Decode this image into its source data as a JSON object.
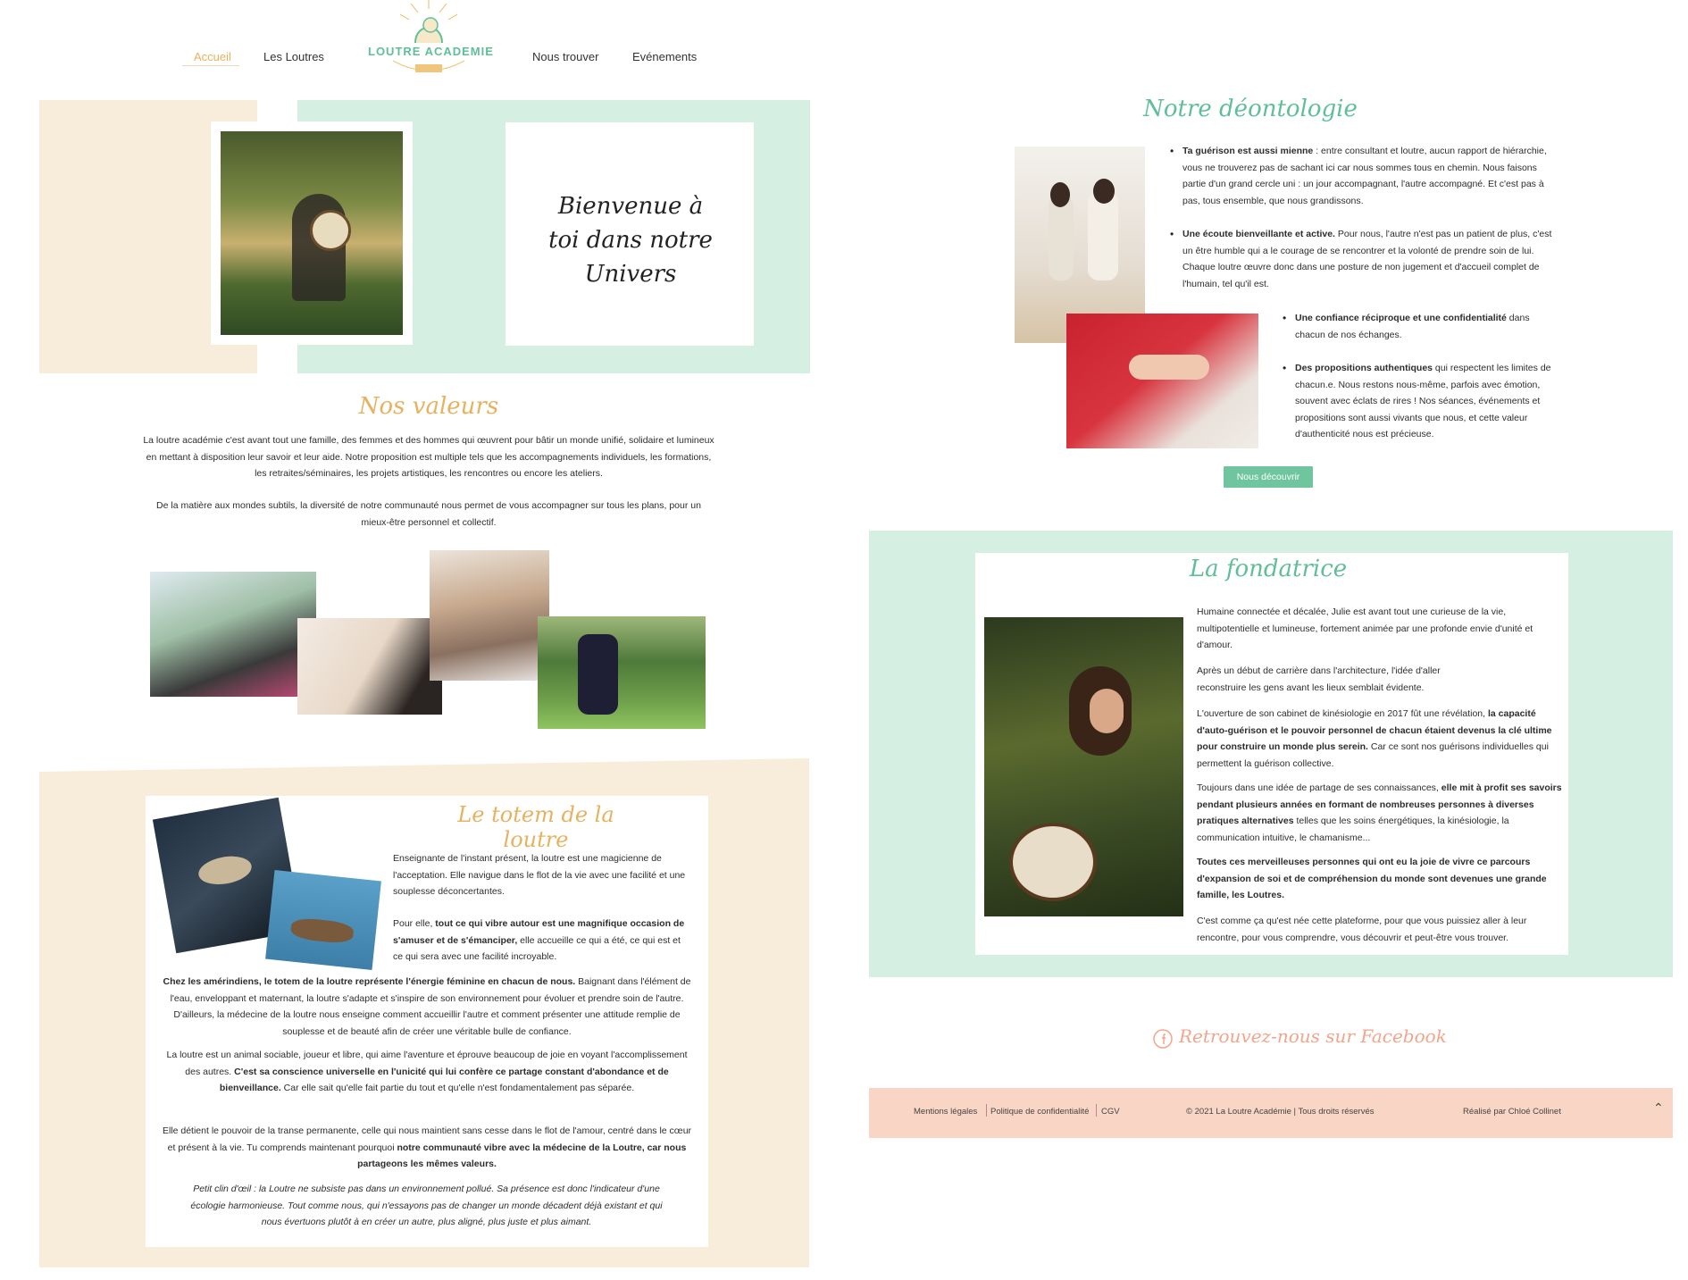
{
  "nav": {
    "items": [
      {
        "label": "Accueil"
      },
      {
        "label": "Les Loutres"
      },
      {
        "label": "Nous trouver"
      },
      {
        "label": "Evénements"
      }
    ],
    "logo_text": "LOUTRE ACADEMIE"
  },
  "hero": {
    "welcome": "Bienvenue à toi dans notre Univers"
  },
  "valeurs": {
    "title": "Nos valeurs",
    "p1": "La loutre académie c'est avant tout une famille, des femmes et des hommes qui œuvrent pour bâtir un monde unifié, solidaire et lumineux en mettant à disposition leur savoir et leur aide. Notre proposition est multiple tels que les accompagnements individuels, les formations, les retraites/séminaires, les projets artistiques, les rencontres ou encore les ateliers.",
    "p2": "De la matière aux mondes subtils, la diversité de notre communauté nous permet de vous accompagner sur tous les plans, pour un mieux-être personnel et collectif."
  },
  "totem": {
    "title": "Le totem de la loutre",
    "p1": "Enseignante de l'instant présent, la loutre est une magicienne de l'acceptation. Elle navigue dans le flot de la vie avec une facilité et une souplesse déconcertantes.",
    "p2_a": "Pour elle, ",
    "p2_b": "tout ce qui vibre autour est une magnifique occasion de s'amuser et de s'émanciper,",
    "p2_c": " elle accueille ce qui a été, ce qui est et ce qui sera avec une facilité incroyable.",
    "p3_a": "Chez les amérindiens, le totem de la loutre représente l'énergie féminine en chacun de nous.",
    "p3_b": " Baignant dans l'élément de l'eau, enveloppant et maternant, la loutre s'adapte et s'inspire de son environnement pour évoluer et prendre soin de l'autre. D'ailleurs, la médecine de la loutre nous enseigne comment accueillir l'autre et comment présenter une attitude remplie de souplesse et de beauté afin de créer une véritable bulle de confiance.",
    "p4_a": "La loutre est un animal sociable, joueur et libre, qui aime l'aventure et éprouve beaucoup de joie en voyant l'accomplissement des autres. ",
    "p4_b": "C'est sa conscience universelle en l'unicité qui lui confère ce partage constant d'abondance et de bienveillance.",
    "p4_c": " Car elle sait qu'elle fait partie du tout et qu'elle n'est fondamentalement pas séparée.",
    "p5_a": "Elle détient le pouvoir de la transe permanente, celle qui nous maintient sans cesse dans le flot de l'amour, centré dans le cœur et présent à la vie. Tu comprends maintenant pourquoi ",
    "p5_b": "notre communauté vibre avec la médecine de la Loutre, car nous partageons les mêmes valeurs.",
    "p6": "Petit clin d'œil : la Loutre ne subsiste pas dans un environnement pollué. Sa présence est donc l'indicateur d'une écologie harmonieuse. Tout comme nous, qui n'essayons pas de changer un monde décadent déjà existant et qui nous évertuons plutôt à en créer un autre, plus aligné, plus juste et plus aimant."
  },
  "deontologie": {
    "title": "Notre déontologie",
    "items": [
      {
        "bold": "Ta guérison est aussi mienne",
        "text": " : entre consultant et loutre, aucun rapport de hiérarchie, vous ne trouverez pas de sachant ici car nous sommes tous en chemin. Nous faisons partie d'un grand cercle uni : un jour accompagnant, l'autre accompagné. Et c'est pas à pas, tous ensemble, que nous grandissons."
      },
      {
        "bold": "Une écoute bienveillante et active.",
        "text": " Pour nous, l'autre n'est pas un patient de plus, c'est un être humble qui a le courage de se rencontrer et la volonté de prendre soin de lui. Chaque loutre œuvre donc dans une posture de non jugement et d'accueil complet de l'humain, tel qu'il est."
      },
      {
        "bold": "Une confiance réciproque et une confidentialité",
        "text": " dans chacun de nos échanges."
      },
      {
        "bold": "Des propositions authentiques",
        "text": " qui respectent les limites de chacun.e. Nous restons nous-même, parfois avec émotion, souvent avec éclats de rires ! Nos séances, événements et propositions sont aussi vivants que nous, et cette valeur d'authenticité nous est précieuse."
      }
    ],
    "button": "Nous découvrir"
  },
  "fondatrice": {
    "title": "La fondatrice",
    "p1": "Humaine connectée et décalée, Julie est avant tout une curieuse de la vie, multipotentielle et lumineuse, fortement animée par une profonde envie d'unité et d'amour.",
    "p2": "Après un début de carrière dans l'architecture, l'idée d'aller reconstruire les gens avant les lieux semblait évidente.",
    "p3_a": "L'ouverture de son cabinet de kinésiologie en 2017 fût une révélation, ",
    "p3_b": "la capacité d'auto-guérison et le pouvoir personnel de chacun étaient devenus la clé ultime pour construire un monde plus serein.",
    "p3_c": " Car ce sont nos guérisons individuelles qui permettent la guérison collective.",
    "p4_a": "Toujours dans une idée de partage de ses connaissances, ",
    "p4_b": "elle mit à profit ses savoirs pendant plusieurs années en formant de nombreuses personnes à diverses pratiques alternatives",
    "p4_c": " telles que les soins énergétiques, la kinésiologie, la communication intuitive, le chamanisme...",
    "p5": "Toutes ces merveilleuses personnes qui ont eu la joie de vivre ce parcours d'expansion de soi et de compréhension du monde sont devenues une grande famille, les Loutres.",
    "p6": "C'est comme ça qu'est née cette plateforme, pour que vous puissiez aller à leur rencontre, pour vous comprendre, vous découvrir et peut-être vous trouver."
  },
  "facebook": {
    "label": "Retrouvez-nous sur Facebook"
  },
  "footer": {
    "links": [
      "Mentions légales",
      "Politique de confidentialité",
      "CGV"
    ],
    "copyright": "© 2021 La Loutre Académie | Tous droits réservés",
    "credit": "Réalisé par Chloé Collinet",
    "top_icon": "chevron-up-icon"
  },
  "colors": {
    "cream": "#f8edda",
    "mint": "#d5efe3",
    "green_text": "#5fbf98",
    "gold_text": "#e7b25f",
    "salmon": "#f9d5c6",
    "salmon_text": "#f3a58c"
  }
}
